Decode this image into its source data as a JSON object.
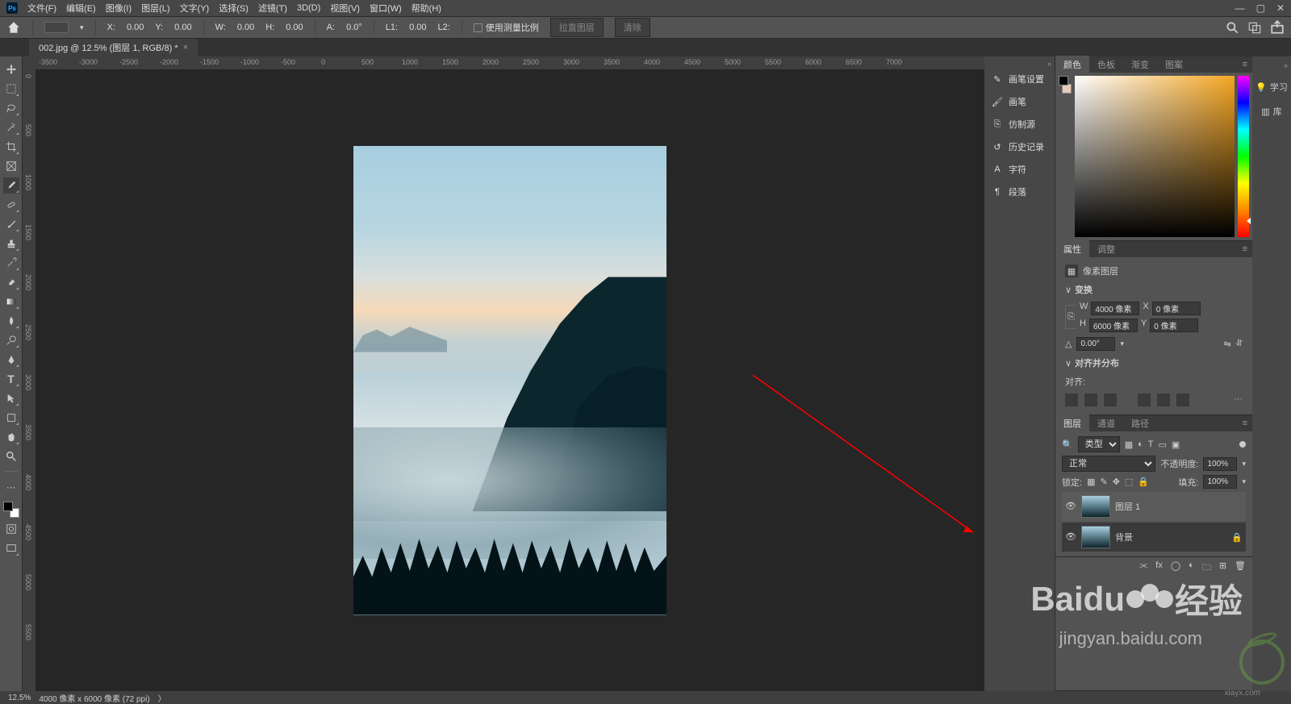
{
  "menubar": {
    "items": [
      "文件(F)",
      "编辑(E)",
      "图像(I)",
      "图层(L)",
      "文字(Y)",
      "选择(S)",
      "滤镜(T)",
      "3D(D)",
      "视图(V)",
      "窗口(W)",
      "帮助(H)"
    ]
  },
  "optionsbar": {
    "x_label": "X:",
    "x_value": "0.00",
    "y_label": "Y:",
    "y_value": "0.00",
    "w_label": "W:",
    "w_value": "0.00",
    "h_label": "H:",
    "h_value": "0.00",
    "a_label": "A:",
    "a_value": "0.0°",
    "l1_label": "L1:",
    "l1_value": "0.00",
    "l2_label": "L2:",
    "scale_checkbox": "使用测量比例",
    "btn1": "拉直图层",
    "btn2": "清除"
  },
  "doctab": {
    "title": "002.jpg @ 12.5% (图层 1, RGB/8) *"
  },
  "ruler_h": [
    "-3500",
    "-3000",
    "-2500",
    "-2000",
    "-1500",
    "-1000",
    "-500",
    "0",
    "500",
    "1000",
    "1500",
    "2000",
    "2500",
    "3000",
    "3500",
    "4000",
    "4500",
    "5000",
    "5500",
    "6000",
    "6500",
    "7000"
  ],
  "ruler_v": [
    "0",
    "500",
    "1000",
    "1500",
    "2000",
    "2500",
    "3000",
    "3500",
    "4000",
    "4500",
    "5000",
    "5500"
  ],
  "collapsed": [
    {
      "icon": "brush",
      "label": "画笔设置"
    },
    {
      "icon": "brush2",
      "label": "画笔"
    },
    {
      "icon": "clone",
      "label": "仿制源"
    },
    {
      "icon": "history",
      "label": "历史记录"
    },
    {
      "icon": "char",
      "label": "字符"
    },
    {
      "icon": "para",
      "label": "段落"
    }
  ],
  "extra": {
    "learn": "学习",
    "lib": "库"
  },
  "color_panel": {
    "tabs": [
      "颜色",
      "色板",
      "渐变",
      "图案"
    ]
  },
  "properties": {
    "tabs": [
      "属性",
      "调整"
    ],
    "type_label": "像素图层",
    "transform_header": "变换",
    "w_label": "W",
    "w_value": "4000 像素",
    "x_label": "X",
    "x_value": "0 像素",
    "h_label": "H",
    "h_value": "6000 像素",
    "y_label": "Y",
    "y_value": "0 像素",
    "angle_label": "△",
    "angle_value": "0.00°",
    "align_header": "对齐并分布",
    "align_label": "对齐:"
  },
  "layers": {
    "tabs": [
      "图层",
      "通道",
      "路径"
    ],
    "filter_label": "类型",
    "blend_mode": "正常",
    "opacity_label": "不透明度:",
    "opacity_value": "100%",
    "lock_label": "锁定:",
    "fill_label": "填充:",
    "fill_value": "100%",
    "layer1": "图层 1",
    "layer2": "背景"
  },
  "statusbar": {
    "zoom": "12.5%",
    "info": "4000 像素 x 6000 像素 (72 ppi)"
  },
  "watermarks": {
    "brand": "Baidu",
    "suffix": "经验",
    "url": "jingyan.baidu.com",
    "small": "xiayx.com"
  }
}
